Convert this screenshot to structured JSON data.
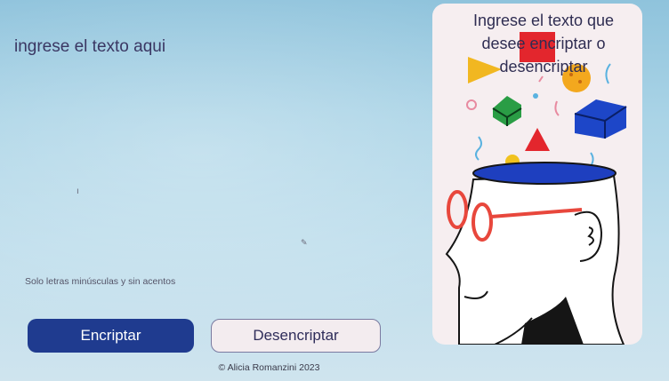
{
  "editor": {
    "placeholder": "ingrese el texto aqui",
    "caret_glyph": "ı",
    "pencil_glyph": "✎"
  },
  "hint": {
    "icon": "info-icon",
    "text": "Solo letras minúsculas y sin acentos"
  },
  "buttons": {
    "encrypt_label": "Encriptar",
    "decrypt_label": "Desencriptar"
  },
  "footer": {
    "text": "© Alicia Romanzini 2023"
  },
  "panel": {
    "message": "Ingrese el texto que desee encriptar o desencriptar",
    "illustration": "head-with-flying-shapes"
  },
  "colors": {
    "primary_button": "#1f3b8f",
    "secondary_button": "#f3ecef",
    "panel_background": "#f6eef0",
    "text": "#3a3763"
  }
}
